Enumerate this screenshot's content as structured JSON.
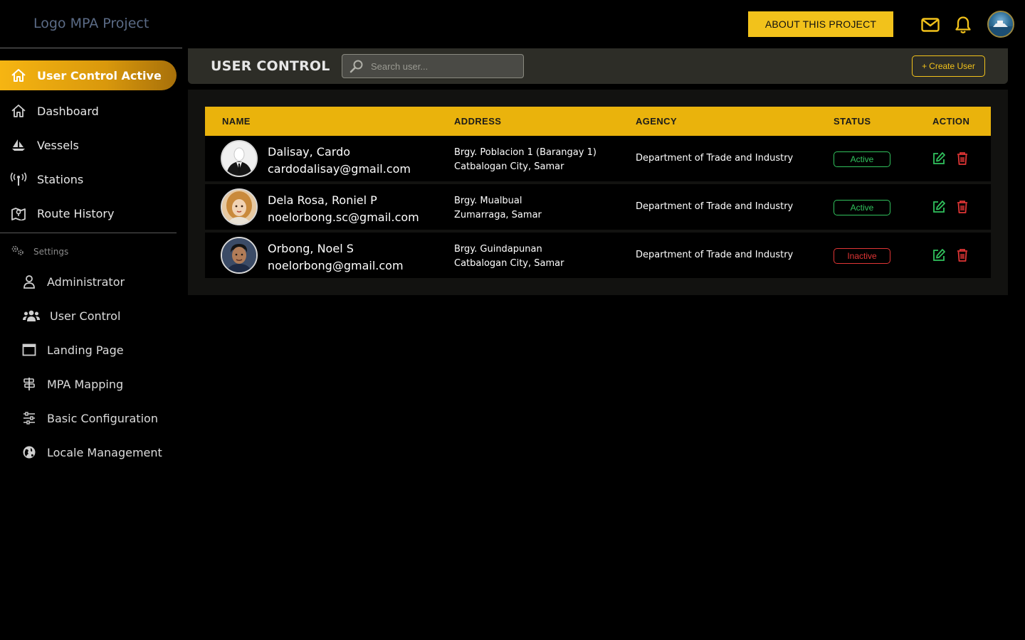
{
  "app": {
    "logo_text": "Logo MPA Project"
  },
  "topbar": {
    "about_label": "ABOUT THIS PROJECT"
  },
  "sidebar": {
    "active_label": "User Control Active",
    "items": [
      {
        "label": "Dashboard",
        "icon": "home-icon"
      },
      {
        "label": "Vessels",
        "icon": "sailboat-icon"
      },
      {
        "label": "Stations",
        "icon": "antenna-icon"
      },
      {
        "label": "Route History",
        "icon": "map-icon"
      }
    ],
    "settings_label": "Settings",
    "settings_items": [
      {
        "label": "Administrator",
        "icon": "user-icon"
      },
      {
        "label": "User Control",
        "icon": "users-icon"
      },
      {
        "label": "Landing Page",
        "icon": "window-icon"
      },
      {
        "label": "MPA Mapping",
        "icon": "signpost-icon"
      },
      {
        "label": "Basic Configuration",
        "icon": "sliders-icon"
      },
      {
        "label": "Locale Management",
        "icon": "globe-icon"
      }
    ]
  },
  "main": {
    "title": "USER CONTROL",
    "search_placeholder": "Search user...",
    "create_label": "Create User",
    "columns": {
      "name": "NAME",
      "address": "ADDRESS",
      "agency": "AGENCY",
      "status": "STATUS",
      "action": "ACTION"
    },
    "rows": [
      {
        "name": "Dalisay, Cardo",
        "email": "cardodalisay@gmail.com",
        "address1": "Brgy. Poblacion 1 (Barangay 1)",
        "address2": "Catbalogan City, Samar",
        "agency": "Department of Trade and Industry",
        "status": "Active"
      },
      {
        "name": "Dela Rosa, Roniel P",
        "email": "noelorbong.sc@gmail.com",
        "address1": "Brgy. Mualbual",
        "address2": "Zumarraga, Samar",
        "agency": "Department of Trade and Industry",
        "status": "Active"
      },
      {
        "name": "Orbong, Noel S",
        "email": "noelorbong@gmail.com",
        "address1": "Brgy. Guindapunan",
        "address2": "Catbalogan City, Samar",
        "agency": "Department of Trade and Industry",
        "status": "Inactive"
      }
    ]
  },
  "colors": {
    "accent": "#f2c21b",
    "active": "#31c25d",
    "inactive": "#e03535",
    "edit": "#31c25d",
    "delete": "#e03535"
  }
}
